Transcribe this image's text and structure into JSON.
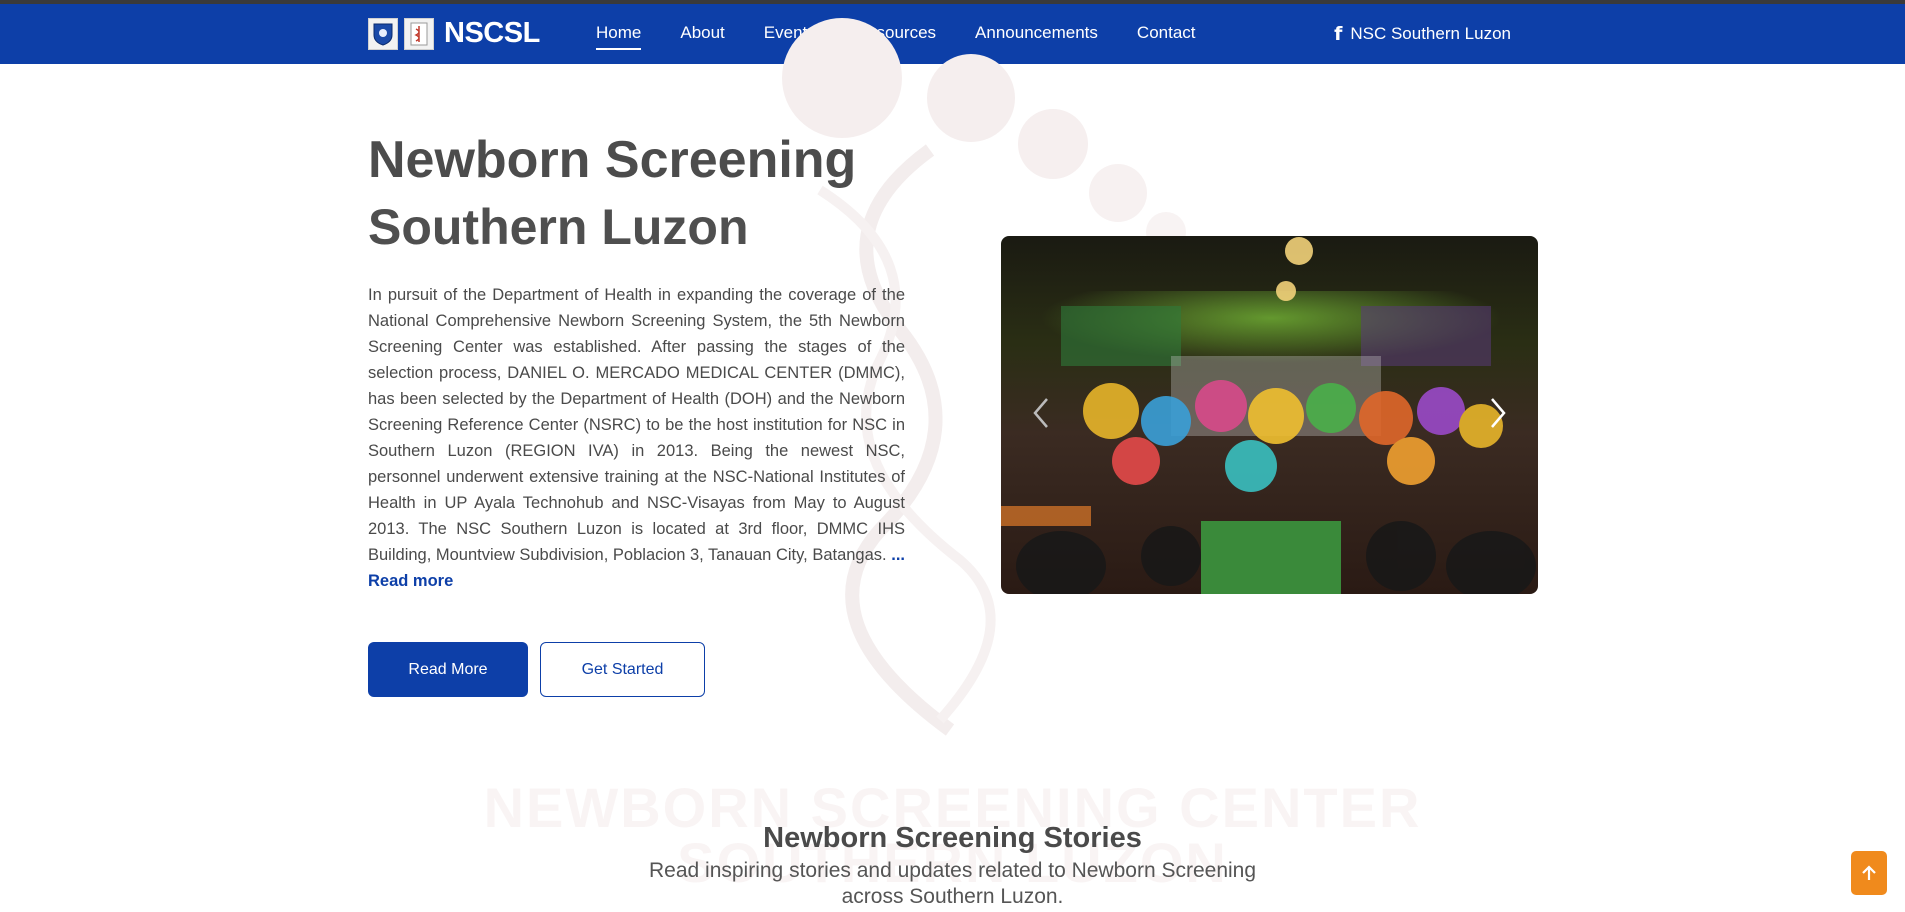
{
  "navbar": {
    "brand": "NSCSL",
    "links": [
      {
        "label": "Home",
        "active": true
      },
      {
        "label": "About"
      },
      {
        "label": "Events"
      },
      {
        "label": "Resources"
      },
      {
        "label": "Announcements"
      },
      {
        "label": "Contact"
      }
    ],
    "facebook": {
      "icon": "facebook-icon",
      "label": "NSC Southern Luzon"
    },
    "color": "#0d3fa8"
  },
  "hero": {
    "title_line1": "Newborn Screening",
    "title_line2": "Southern Luzon",
    "description": "In pursuit of the Department of Health in expanding the coverage of the National Comprehensive Newborn Screening System, the 5th Newborn Screening Center was established. After passing the stages of the selection process, DANIEL O. MERCADO MEDICAL CENTER (DMMC), has been selected by the Department of Health (DOH) and the Newborn Screening Reference Center (NSRC) to be the host institution for NSC in Southern Luzon (REGION IVA) in 2013. Being the newest NSC, personnel underwent extensive training at the NSC-National Institutes of Health in UP Ayala Technohub and NSC-Visayas from May to August 2013. The NSC Southern Luzon is located at 3rd floor, DMMC IHS Building, Mountview Subdivision, Poblacion 3, Tanauan City, Batangas.",
    "read_more_link": "... Read more",
    "primary_button": "Read More",
    "secondary_button": "Get Started"
  },
  "carousel": {
    "prev_icon": "chevron-left-icon",
    "next_icon": "chevron-right-icon"
  },
  "stories": {
    "watermark_line1": "NEWBORN SCREENING CENTER",
    "watermark_line2": "SOUTHERN LUZON",
    "title": "Newborn Screening Stories",
    "subtitle": "Read inspiring stories and updates related to Newborn Screening across Southern Luzon."
  },
  "scroll_top": {
    "icon": "arrow-up-icon",
    "color": "#f08a1c"
  }
}
